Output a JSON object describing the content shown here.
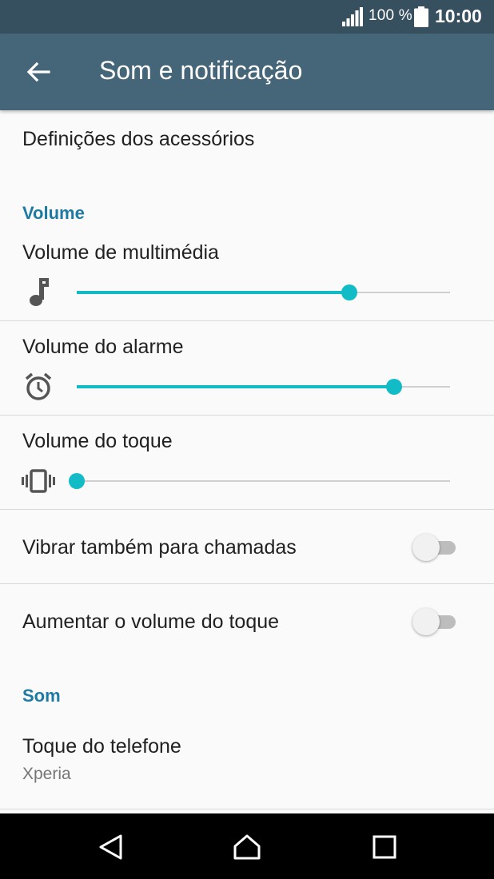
{
  "status_bar": {
    "battery_text": "100 %",
    "time": "10:00",
    "icons": [
      "signal-icon",
      "battery-icon"
    ]
  },
  "app_bar": {
    "title": "Som e notificação",
    "back_icon": "arrow-left-icon"
  },
  "items": {
    "accessories": "Definições dos acessórios",
    "volume_section": "Volume",
    "media_volume": {
      "label": "Volume de multimédia",
      "icon": "music-note-icon",
      "level": 0.73
    },
    "alarm_volume": {
      "label": "Volume do alarme",
      "icon": "alarm-clock-icon",
      "level": 0.85
    },
    "ring_volume": {
      "label": "Volume do toque",
      "icon": "vibrate-icon",
      "level": 0.0
    },
    "vibrate_calls": {
      "label": "Vibrar também para chamadas",
      "on": false
    },
    "increase_ring": {
      "label": "Aumentar o volume do toque",
      "on": false
    },
    "sound_section": "Som",
    "ringtone": {
      "label": "Toque do telefone",
      "value": "Xperia"
    }
  },
  "nav_bar": {
    "icons": [
      "back-triangle-icon",
      "home-icon",
      "recents-icon"
    ]
  },
  "colors": {
    "status_bar": "#37505f",
    "app_bar": "#456678",
    "accent": "#12bcc7",
    "section_header": "#1e7aa3"
  }
}
